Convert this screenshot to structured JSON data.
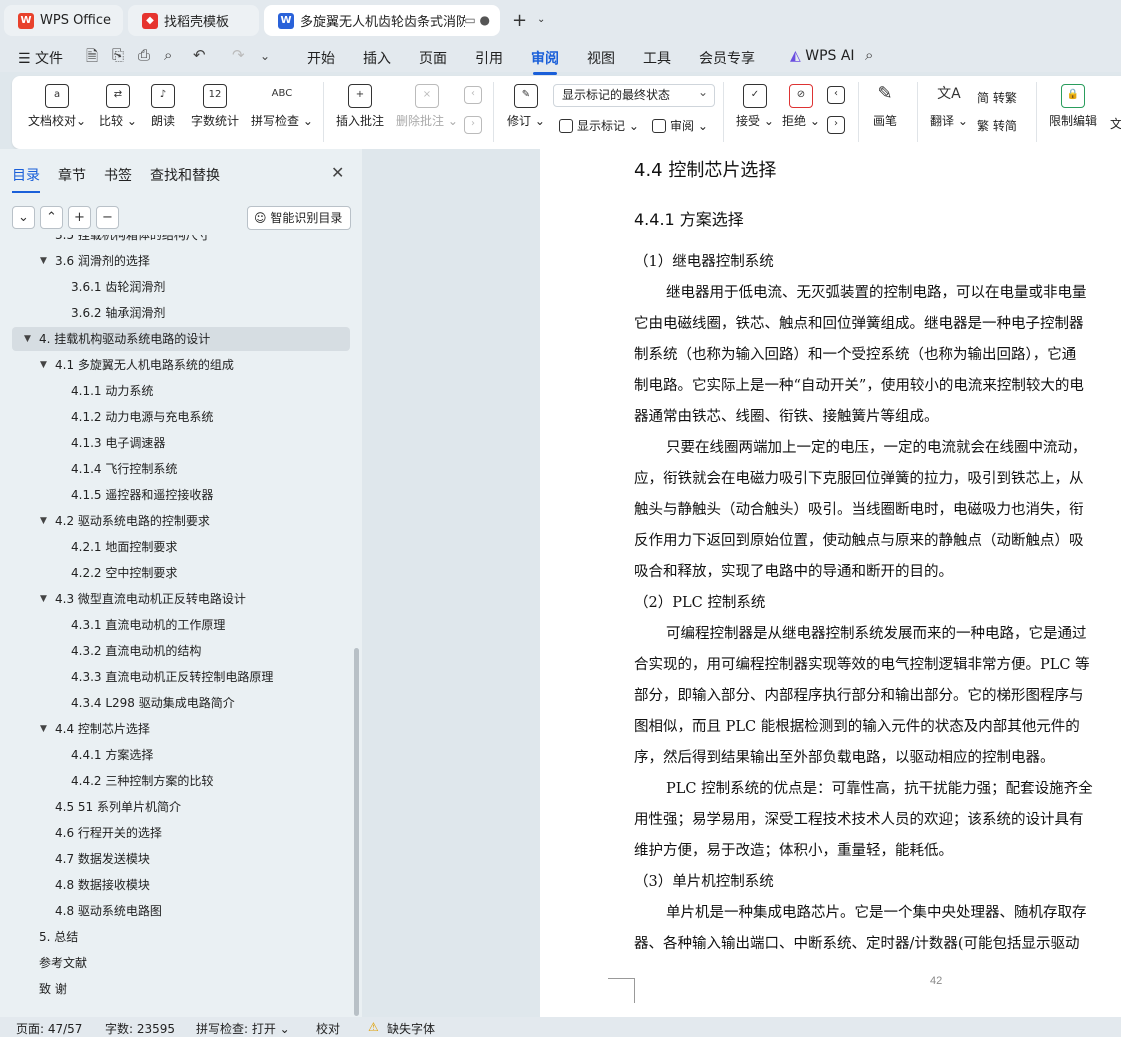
{
  "tabs": [
    {
      "label": "WPS Office",
      "icon": "wps-logo-icon"
    },
    {
      "label": "找稻壳模板",
      "icon": "docer-icon"
    },
    {
      "label": "多旋翼无人机齿轮齿条式消防灭火",
      "icon": "word-doc-icon"
    }
  ],
  "tab_active_icons": "▭ ●",
  "menu": {
    "file": "文件",
    "items": [
      "开始",
      "插入",
      "页面",
      "引用",
      "审阅",
      "视图",
      "工具",
      "会员专享"
    ],
    "active": "审阅",
    "ai": "WPS AI"
  },
  "ribbon": {
    "b1": "文档校对",
    "b1_arrow": "⌄",
    "b2": "比较",
    "b3": "朗读",
    "b4": "字数统计",
    "b5": "拼写检查",
    "b5_top": "ABC",
    "b6": "插入批注",
    "b7": "删除批注",
    "b8": "修订",
    "markup_select": "显示标记的最终状态",
    "b9": "显示标记",
    "b10": "审阅",
    "b11": "接受",
    "b12": "拒绝",
    "b13": "画笔",
    "b14": "翻译",
    "b15": "繁转简",
    "b15s": "简 转繁",
    "b16": "繁 转简",
    "b17": "限制编辑",
    "b18": "文"
  },
  "nav": {
    "tabs": [
      "目录",
      "章节",
      "书签",
      "查找和替换"
    ],
    "close": "✕",
    "buttons": [
      "⌄",
      "⌃",
      "+",
      "−"
    ],
    "smart": "智能识别目录",
    "toc": [
      {
        "text": "3.5   挂载机构箱体的结构尺寸",
        "level": 1,
        "caret": ""
      },
      {
        "text": "3.6   润滑剂的选择",
        "level": 1,
        "caret": "▼"
      },
      {
        "text": "3.6.1   齿轮润滑剂",
        "level": 2,
        "caret": ""
      },
      {
        "text": "3.6.2   轴承润滑剂",
        "level": 2,
        "caret": ""
      },
      {
        "text": "4.  挂载机构驱动系统电路的设计",
        "level": 0,
        "caret": "▼"
      },
      {
        "text": "4.1   多旋翼无人机电路系统的组成",
        "level": 1,
        "caret": "▼"
      },
      {
        "text": "4.1.1   动力系统",
        "level": 2,
        "caret": ""
      },
      {
        "text": "4.1.2   动力电源与充电系统",
        "level": 2,
        "caret": ""
      },
      {
        "text": "4.1.3   电子调速器",
        "level": 2,
        "caret": ""
      },
      {
        "text": "4.1.4   飞行控制系统",
        "level": 2,
        "caret": ""
      },
      {
        "text": "4.1.5   遥控器和遥控接收器",
        "level": 2,
        "caret": ""
      },
      {
        "text": "4.2   驱动系统电路的控制要求",
        "level": 1,
        "caret": "▼"
      },
      {
        "text": "4.2.1   地面控制要求",
        "level": 2,
        "caret": ""
      },
      {
        "text": "4.2.2   空中控制要求",
        "level": 2,
        "caret": ""
      },
      {
        "text": "4.3   微型直流电动机正反转电路设计",
        "level": 1,
        "caret": "▼"
      },
      {
        "text": "4.3.1   直流电动机的工作原理",
        "level": 2,
        "caret": ""
      },
      {
        "text": "4.3.2   直流电动机的结构",
        "level": 2,
        "caret": ""
      },
      {
        "text": "4.3.3   直流电动机正反转控制电路原理",
        "level": 2,
        "caret": ""
      },
      {
        "text": "4.3.4     L298 驱动集成电路简介",
        "level": 2,
        "caret": ""
      },
      {
        "text": "4.4   控制芯片选择",
        "level": 1,
        "caret": "▼"
      },
      {
        "text": "4.4.1   方案选择",
        "level": 2,
        "caret": ""
      },
      {
        "text": "4.4.2   三种控制方案的比较",
        "level": 2,
        "caret": ""
      },
      {
        "text": "4.5   51 系列单片机简介",
        "level": 1,
        "caret": ""
      },
      {
        "text": "4.6   行程开关的选择",
        "level": 1,
        "caret": ""
      },
      {
        "text": "4.7 数据发送模块",
        "level": 1,
        "caret": ""
      },
      {
        "text": "4.8   数据接收模块",
        "level": 1,
        "caret": ""
      },
      {
        "text": "4.8   驱动系统电路图",
        "level": 1,
        "caret": ""
      },
      {
        "text": "5.  总结",
        "level": 0,
        "caret": ""
      },
      {
        "text": "参考文献",
        "level": 0,
        "caret": ""
      },
      {
        "text": "致      谢",
        "level": 0,
        "caret": ""
      }
    ],
    "selected_index": 4
  },
  "doc": {
    "h2": "4.4    控制芯片选择",
    "h3": "4.4.1    方案选择",
    "lines": [
      {
        "t": "（1）继电器控制系统",
        "ind": false
      },
      {
        "t": "继电器用于低电流、无灭弧装置的控制电路，可以在电量或非电量",
        "ind": true
      },
      {
        "t": "它由电磁线圈，铁芯、触点和回位弹簧组成。继电器是一种电子控制器",
        "ind": false
      },
      {
        "t": "制系统（也称为输入回路）和一个受控系统（也称为输出回路），它通",
        "ind": false
      },
      {
        "t": "制电路。它实际上是一种“自动开关”，使用较小的电流来控制较大的电",
        "ind": false
      },
      {
        "t": "器通常由铁芯、线圈、衔铁、接触簧片等组成。",
        "ind": false
      },
      {
        "t": "只要在线圈两端加上一定的电压，一定的电流就会在线圈中流动，",
        "ind": true
      },
      {
        "t": "应，衔铁就会在电磁力吸引下克服回位弹簧的拉力，吸引到铁芯上，从",
        "ind": false
      },
      {
        "t": "触头与静触头（动合触头）吸引。当线圈断电时，电磁吸力也消失，衔",
        "ind": false
      },
      {
        "t": "反作用力下返回到原始位置，使动触点与原来的静触点（动断触点）吸",
        "ind": false
      },
      {
        "t": "吸合和释放，实现了电路中的导通和断开的目的。",
        "ind": false
      },
      {
        "t": "（2）PLC 控制系统",
        "ind": false
      },
      {
        "t": "可编程控制器是从继电器控制系统发展而来的一种电路，它是通过",
        "ind": true
      },
      {
        "t": "合实现的，用可编程控制器实现等效的电气控制逻辑非常方便。PLC 等",
        "ind": false
      },
      {
        "t": "部分，即输入部分、内部程序执行部分和输出部分。它的梯形图程序与",
        "ind": false
      },
      {
        "t": "图相似，而且 PLC 能根据检测到的输入元件的状态及内部其他元件的",
        "ind": false
      },
      {
        "t": "序，然后得到结果输出至外部负载电路，以驱动相应的控制电器。",
        "ind": false
      },
      {
        "t": "PLC 控制系统的优点是：可靠性高，抗干扰能力强；配套设施齐全",
        "ind": true
      },
      {
        "t": "用性强；易学易用，深受工程技术技术人员的欢迎；该系统的设计具有",
        "ind": false
      },
      {
        "t": "维护方便，易于改造；体积小，重量轻，能耗低。",
        "ind": false
      },
      {
        "t": "（3）单片机控制系统",
        "ind": false
      },
      {
        "t": "单片机是一种集成电路芯片。它是一个集中央处理器、随机存取存",
        "ind": true
      },
      {
        "t": "器、各种输入输出端口、中断系统、定时器/计数器(可能包括显示驱动",
        "ind": false
      }
    ],
    "page_number": "42"
  },
  "status": {
    "page": "页面: 47/57",
    "words": "字数: 23595",
    "spell": "拼写检查: 打开 ⌄",
    "proof": "校对",
    "missing": "缺失字体"
  },
  "colors": {
    "accent": "#1a5fd9",
    "wps_red": "#e8412c",
    "docer_red": "#e6342f",
    "doc_blue": "#2a62d9"
  }
}
